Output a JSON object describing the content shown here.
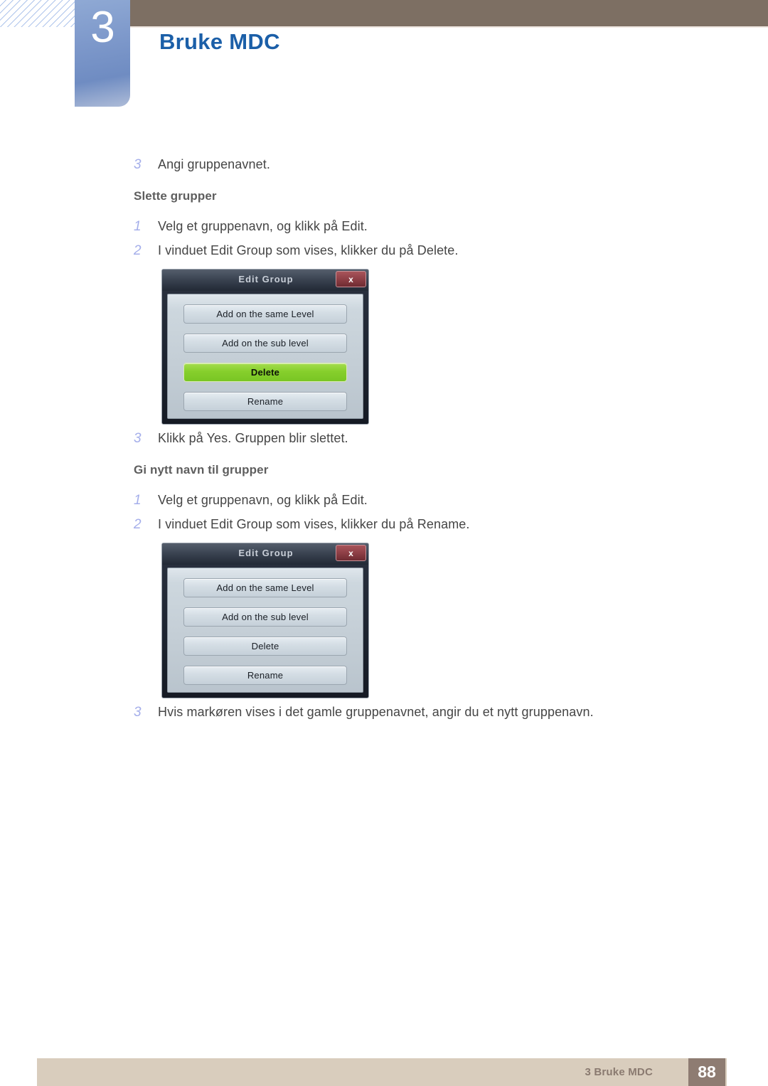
{
  "header": {
    "chapter_number": "3",
    "chapter_title": "Bruke MDC",
    "bar_color": "#7d6f63",
    "tab_color": "#7e99cb",
    "title_color": "#1b5fa8"
  },
  "content": {
    "step_a": {
      "num": "3",
      "text": "Angi gruppenavnet."
    },
    "subhead_1": "Slette grupper",
    "step_b1": {
      "num": "1",
      "text": "Velg et gruppenavn, og klikk på Edit."
    },
    "step_b2": {
      "num": "2",
      "text": "I vinduet Edit Group som vises, klikker du på Delete."
    },
    "step_b3": {
      "num": "3",
      "text": "Klikk på Yes. Gruppen blir slettet."
    },
    "subhead_2": "Gi nytt navn til grupper",
    "step_c1": {
      "num": "1",
      "text": "Velg et gruppenavn, og klikk på Edit."
    },
    "step_c2": {
      "num": "2",
      "text": "I vinduet Edit Group som vises, klikker du på Rename."
    },
    "step_c3": {
      "num": "3",
      "text": "Hvis markøren vises i det gamle gruppenavnet, angir du et nytt gruppenavn."
    }
  },
  "dialog_one": {
    "title": "Edit Group",
    "close_label": "x",
    "buttons": [
      {
        "label": "Add on the same Level",
        "highlighted": false
      },
      {
        "label": "Add on the sub level",
        "highlighted": false
      },
      {
        "label": "Delete",
        "highlighted": true
      },
      {
        "label": "Rename",
        "highlighted": false
      }
    ],
    "highlight_color": "#86cf2c"
  },
  "dialog_two": {
    "title": "Edit Group",
    "close_label": "x",
    "buttons": [
      {
        "label": "Add on the same Level",
        "highlighted": false
      },
      {
        "label": "Add on the sub level",
        "highlighted": false
      },
      {
        "label": "Delete",
        "highlighted": false
      },
      {
        "label": "Rename",
        "highlighted": false
      }
    ]
  },
  "footer": {
    "text": "3 Bruke MDC",
    "page_number": "88",
    "bar_color": "#d9cdbd",
    "page_box_color": "#8e7c72"
  }
}
